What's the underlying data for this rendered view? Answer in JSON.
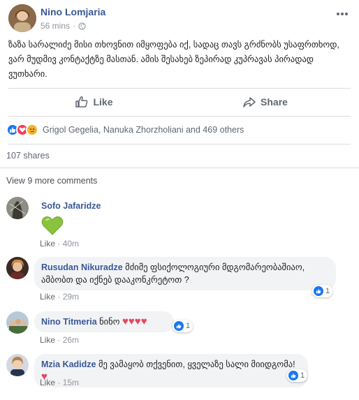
{
  "post": {
    "author": "Nino Lomjaria",
    "time": "56 mins",
    "meta_separator": "·",
    "text": "ზაზა სარალიძე მისი თხოვნით იმყოფება იქ, სადაც თავს გრძნობს უსაფრთხოდ, ვარ მუდმივ კონტაქტზე მასთან. ამის შესახებ ზეპირად კუპრავას პირადად ვუთხარი."
  },
  "actions": {
    "like_label": "Like",
    "share_label": "Share"
  },
  "reactions": {
    "summary": "Grigol Gegelia, Nanuka Zhorzholiani and 469 others"
  },
  "shares": "107 shares",
  "view_more": "View 9 more comments",
  "comments": [
    {
      "name": "Sofo Jafaridze",
      "text": "",
      "meta_like": "Like",
      "time": "40m",
      "sticker": "green-heart"
    },
    {
      "name": "Rusudan Nikuradze",
      "text": "მძიმე ფსიქოლოგიური მდგომარეობაშიაო, ამბობთ და იქნებ დააკონკრეტოთ ?",
      "meta_like": "Like",
      "time": "29m",
      "reaction_count": "1"
    },
    {
      "name": "Nino Titmeria",
      "text": "ნინო",
      "meta_like": "Like",
      "time": "26m",
      "reaction_count": "1"
    },
    {
      "name": "Mzia Kadidze",
      "text": "მე ვამაყობ თქვენით, ყველაზე სალი მიიდგომა!",
      "meta_like": "Like",
      "time": "15m",
      "reaction_count": "1"
    }
  ],
  "colors": {
    "link": "#385898",
    "like_blue": "#1877f2",
    "heart_red": "#e8465f",
    "bubble_bg": "#f2f3f5"
  },
  "icons": [
    "globe-icon",
    "more-icon",
    "thumbs-up-icon",
    "share-arrow-icon",
    "like-reaction-icon",
    "love-reaction-icon",
    "sad-reaction-icon",
    "green-heart-sticker"
  ]
}
